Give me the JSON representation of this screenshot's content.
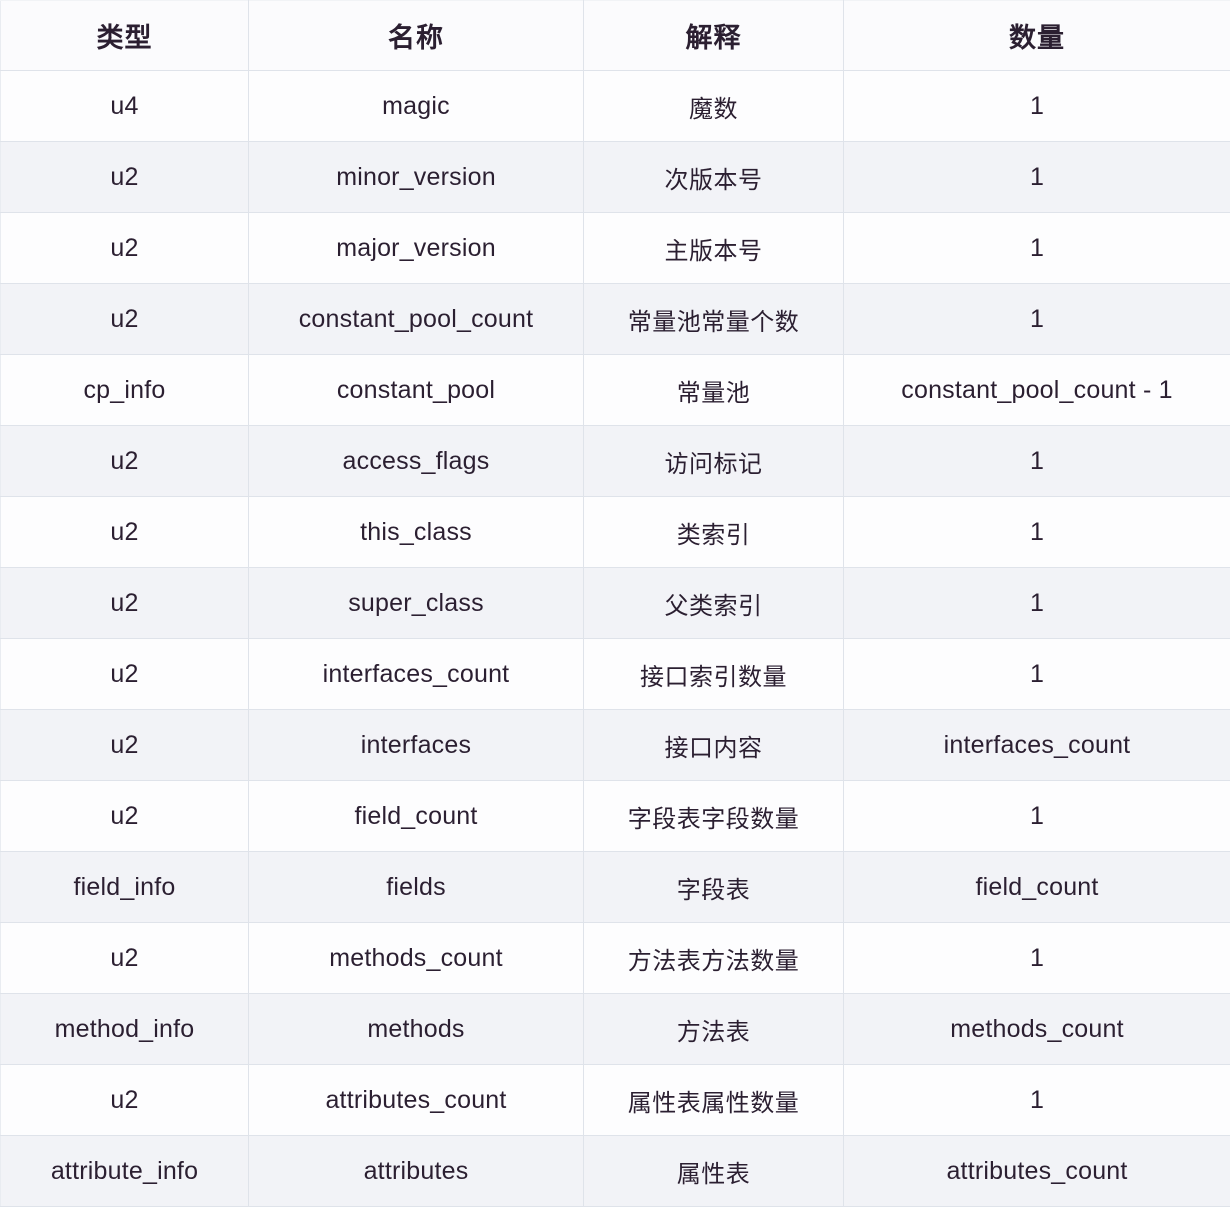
{
  "table": {
    "name": "class-file-structure",
    "columns": [
      {
        "key": "type",
        "label": "类型"
      },
      {
        "key": "name",
        "label": "名称"
      },
      {
        "key": "desc",
        "label": "解释"
      },
      {
        "key": "quantity",
        "label": "数量"
      }
    ],
    "rows": [
      {
        "type": "u4",
        "name": "magic",
        "desc": "魔数",
        "quantity": "1"
      },
      {
        "type": "u2",
        "name": "minor_version",
        "desc": "次版本号",
        "quantity": "1"
      },
      {
        "type": "u2",
        "name": "major_version",
        "desc": "主版本号",
        "quantity": "1"
      },
      {
        "type": "u2",
        "name": "constant_pool_count",
        "desc": "常量池常量个数",
        "quantity": "1"
      },
      {
        "type": "cp_info",
        "name": "constant_pool",
        "desc": "常量池",
        "quantity": "constant_pool_count - 1"
      },
      {
        "type": "u2",
        "name": "access_flags",
        "desc": "访问标记",
        "quantity": "1"
      },
      {
        "type": "u2",
        "name": "this_class",
        "desc": "类索引",
        "quantity": "1"
      },
      {
        "type": "u2",
        "name": "super_class",
        "desc": "父类索引",
        "quantity": "1"
      },
      {
        "type": "u2",
        "name": "interfaces_count",
        "desc": "接口索引数量",
        "quantity": "1"
      },
      {
        "type": "u2",
        "name": "interfaces",
        "desc": "接口内容",
        "quantity": "interfaces_count"
      },
      {
        "type": "u2",
        "name": "field_count",
        "desc": "字段表字段数量",
        "quantity": "1"
      },
      {
        "type": "field_info",
        "name": "fields",
        "desc": "字段表",
        "quantity": "field_count"
      },
      {
        "type": "u2",
        "name": "methods_count",
        "desc": "方法表方法数量",
        "quantity": "1"
      },
      {
        "type": "method_info",
        "name": "methods",
        "desc": "方法表",
        "quantity": "methods_count"
      },
      {
        "type": "u2",
        "name": "attributes_count",
        "desc": "属性表属性数量",
        "quantity": "1"
      },
      {
        "type": "attribute_info",
        "name": "attributes",
        "desc": "属性表",
        "quantity": "attributes_count"
      }
    ]
  },
  "colors": {
    "text": "#2b1f31",
    "border": "#dfe3ea",
    "row_shaded": "#f2f3f7",
    "row_plain": "#fdfdfe",
    "header_bg": "#fbfbfd"
  }
}
